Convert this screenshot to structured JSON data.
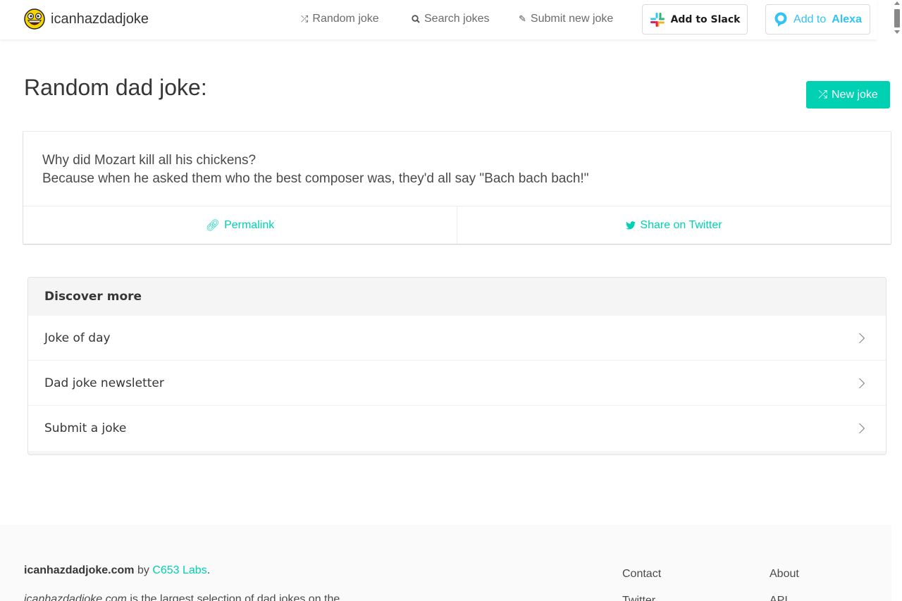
{
  "nav": {
    "brand": "icanhazdadjoke",
    "links": [
      {
        "label": "Random joke",
        "icon": "shuffle-icon"
      },
      {
        "label": "Search jokes",
        "icon": "search-icon"
      },
      {
        "label": "Submit new joke",
        "icon": "edit-icon"
      }
    ],
    "slack_label": "Add to Slack",
    "alexa_prefix": "Add to",
    "alexa_brand": "Alexa"
  },
  "main": {
    "title": "Random dad joke:",
    "new_joke_label": "New joke",
    "joke_line1": "Why did Mozart kill all his chickens?",
    "joke_line2": "Because when he asked them who the best composer was, they'd all say \"Bach bach bach!\"",
    "permalink_label": "Permalink",
    "share_label": "Share on Twitter"
  },
  "discover": {
    "heading": "Discover more",
    "items": [
      "Joke of day",
      "Dad joke newsletter",
      "Submit a joke"
    ]
  },
  "footer": {
    "site": "icanhazdadjoke.com",
    "by": "by",
    "lab": "C653 Labs",
    "period": ".",
    "desc_site": "icanhazdadjoke.com",
    "desc_rest": " is the largest selection of dad jokes on the",
    "col1": [
      "Contact",
      "Twitter"
    ],
    "col2": [
      "About",
      "API"
    ]
  },
  "colors": {
    "accent": "#00d1b2",
    "alexa": "#31c4f3",
    "slack_text": "#1d1c1d"
  }
}
